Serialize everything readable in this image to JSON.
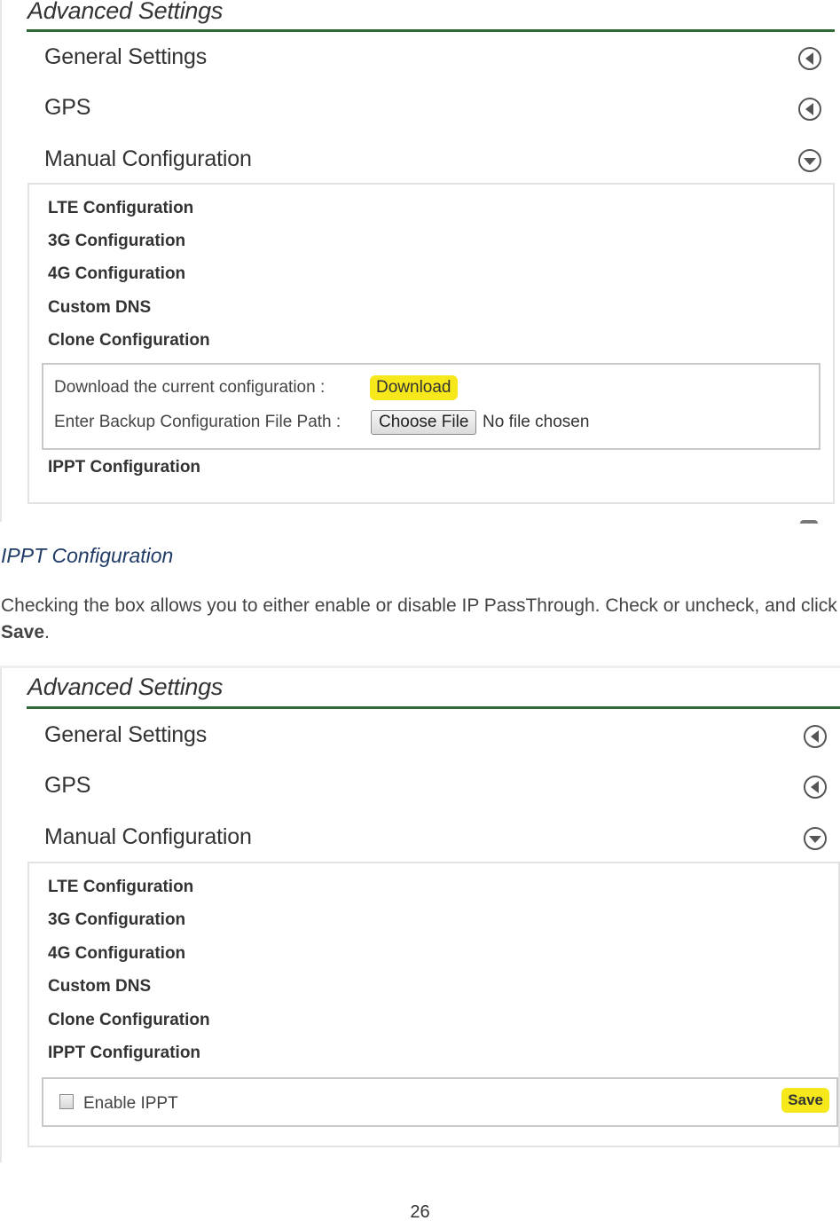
{
  "screenshot_1": {
    "title": "Advanced Settings",
    "accordion": [
      {
        "label": "General Settings",
        "icon": "collapsed-arrow-left-icon",
        "state": "collapsed"
      },
      {
        "label": "GPS",
        "icon": "collapsed-arrow-left-icon",
        "state": "collapsed"
      },
      {
        "label": "Manual Configuration",
        "icon": "expanded-arrow-down-icon",
        "state": "expanded"
      }
    ],
    "manual_items": [
      "LTE Configuration",
      "3G Configuration",
      "4G Configuration",
      "Custom DNS",
      "Clone Configuration"
    ],
    "clone": {
      "download_label": "Download the current configuration :",
      "download_button": "Download",
      "backup_label": "Enter Backup Configuration File Path :",
      "choose_file_button": "Choose File",
      "file_status": "No file chosen"
    },
    "after_item": "IPPT Configuration"
  },
  "document": {
    "heading": "IPPT Configuration",
    "paragraph_text": "Checking the box allows you to either enable or disable IP PassThrough.  Check or uncheck, and click ",
    "paragraph_bold": "Save",
    "paragraph_end": "."
  },
  "screenshot_2": {
    "title": "Advanced Settings",
    "accordion": [
      {
        "label": "General Settings",
        "icon": "collapsed-arrow-left-icon",
        "state": "collapsed"
      },
      {
        "label": "GPS",
        "icon": "collapsed-arrow-left-icon",
        "state": "collapsed"
      },
      {
        "label": "Manual Configuration",
        "icon": "expanded-arrow-down-icon",
        "state": "expanded"
      }
    ],
    "manual_items": [
      "LTE Configuration",
      "3G Configuration",
      "4G Configuration",
      "Custom DNS",
      "Clone Configuration",
      "IPPT Configuration"
    ],
    "ippt": {
      "checkbox_label": "Enable IPPT",
      "checked": false,
      "save_button": "Save"
    }
  },
  "page_number": "26",
  "colors": {
    "accent_green": "#2e6b35",
    "button_yellow": "#f7e81b",
    "heading_blue": "#1f3b66"
  }
}
